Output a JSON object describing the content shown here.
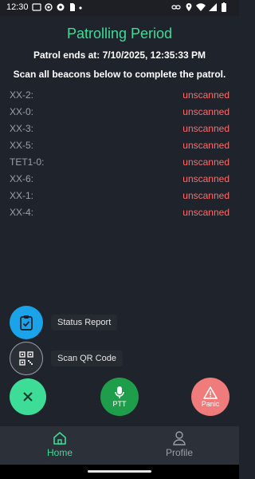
{
  "status_bar": {
    "time": "12:30",
    "left_icons": [
      "cast-icon",
      "settings-icon",
      "gear-icon",
      "file-icon",
      "dot-icon"
    ],
    "right_icons": [
      "link-icon",
      "location-icon",
      "wifi-icon",
      "signal-icon",
      "battery-icon"
    ]
  },
  "header": {
    "title": "Patrolling Period",
    "patrol_ends": "Patrol ends at: 7/10/2025, 12:35:33 PM",
    "instruction": "Scan all beacons below to complete the patrol."
  },
  "beacons": [
    {
      "name": "XX-2:",
      "status": "unscanned"
    },
    {
      "name": "XX-0:",
      "status": "unscanned"
    },
    {
      "name": "XX-3:",
      "status": "unscanned"
    },
    {
      "name": "XX-5:",
      "status": "unscanned"
    },
    {
      "name": "TET1-0:",
      "status": "unscanned"
    },
    {
      "name": "XX-6:",
      "status": "unscanned"
    },
    {
      "name": "XX-1:",
      "status": "unscanned"
    },
    {
      "name": "XX-4:",
      "status": "unscanned"
    }
  ],
  "speed_dial": {
    "status_report_label": "Status Report",
    "scan_qr_label": "Scan QR Code"
  },
  "buttons": {
    "ptt_label": "PTT",
    "panic_label": "Panic"
  },
  "bottom_nav": {
    "home_label": "Home",
    "profile_label": "Profile"
  },
  "colors": {
    "accent_green": "#3ddc97",
    "unscanned_red": "#ff6b6b",
    "status_blue": "#1aa3e8",
    "ptt_green": "#1e9e4a",
    "panic_red": "#f07b7b"
  }
}
